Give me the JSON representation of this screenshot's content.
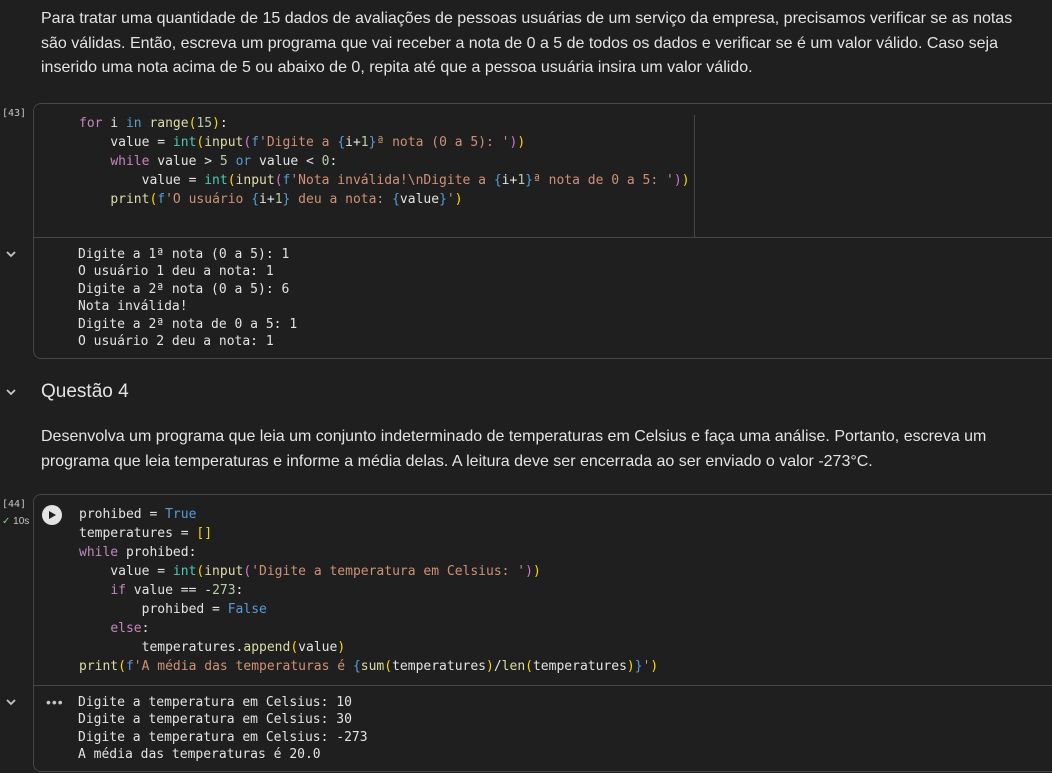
{
  "intro_text": "Para tratar uma quantidade de 15 dados de avaliações de pessoas usuárias de um serviço da empresa, precisamos verificar se as notas são válidas. Então, escreva um programa que vai receber a nota de 0 a 5 de todos os dados e verificar se é um valor válido. Caso seja inserido uma nota acima de 5 ou abaixo de 0, repita até que a pessoa usuária insira um valor válido.",
  "cell43": {
    "exec_count": "[43]",
    "output_lines": [
      "Digite a 1ª nota (0 a 5): 1",
      "O usuário 1 deu a nota: 1",
      "Digite a 2ª nota (0 a 5): 6",
      "Nota inválida!",
      "Digite a 2ª nota de 0 a 5: 1",
      "O usuário 2 deu a nota: 1"
    ]
  },
  "section": {
    "title": "Questão 4"
  },
  "question4_text": "Desenvolva um programa que leia um conjunto indeterminado de temperaturas em Celsius e faça uma análise. Portanto, escreva um programa que leia temperaturas e informe a média delas. A leitura deve ser encerrada ao ser enviado o valor -273°C.",
  "cell44": {
    "exec_count": "[44]",
    "status_check": "✓",
    "status_time": "10s",
    "output_more": "•••",
    "output_lines": [
      "Digite a temperatura em Celsius: 10",
      "Digite a temperatura em Celsius: 30",
      "Digite a temperatura em Celsius: -273",
      "A média das temperaturas é 20.0"
    ]
  },
  "icons": {
    "chevron": "chevron-down-icon",
    "run": "play-icon"
  },
  "colors": {
    "background": "#1f1f1f",
    "keyword": "#569cd6",
    "control": "#c586c0",
    "function": "#dcdcaa",
    "builtin": "#4ec9b0",
    "string": "#ce9178",
    "number": "#b5cea8"
  }
}
